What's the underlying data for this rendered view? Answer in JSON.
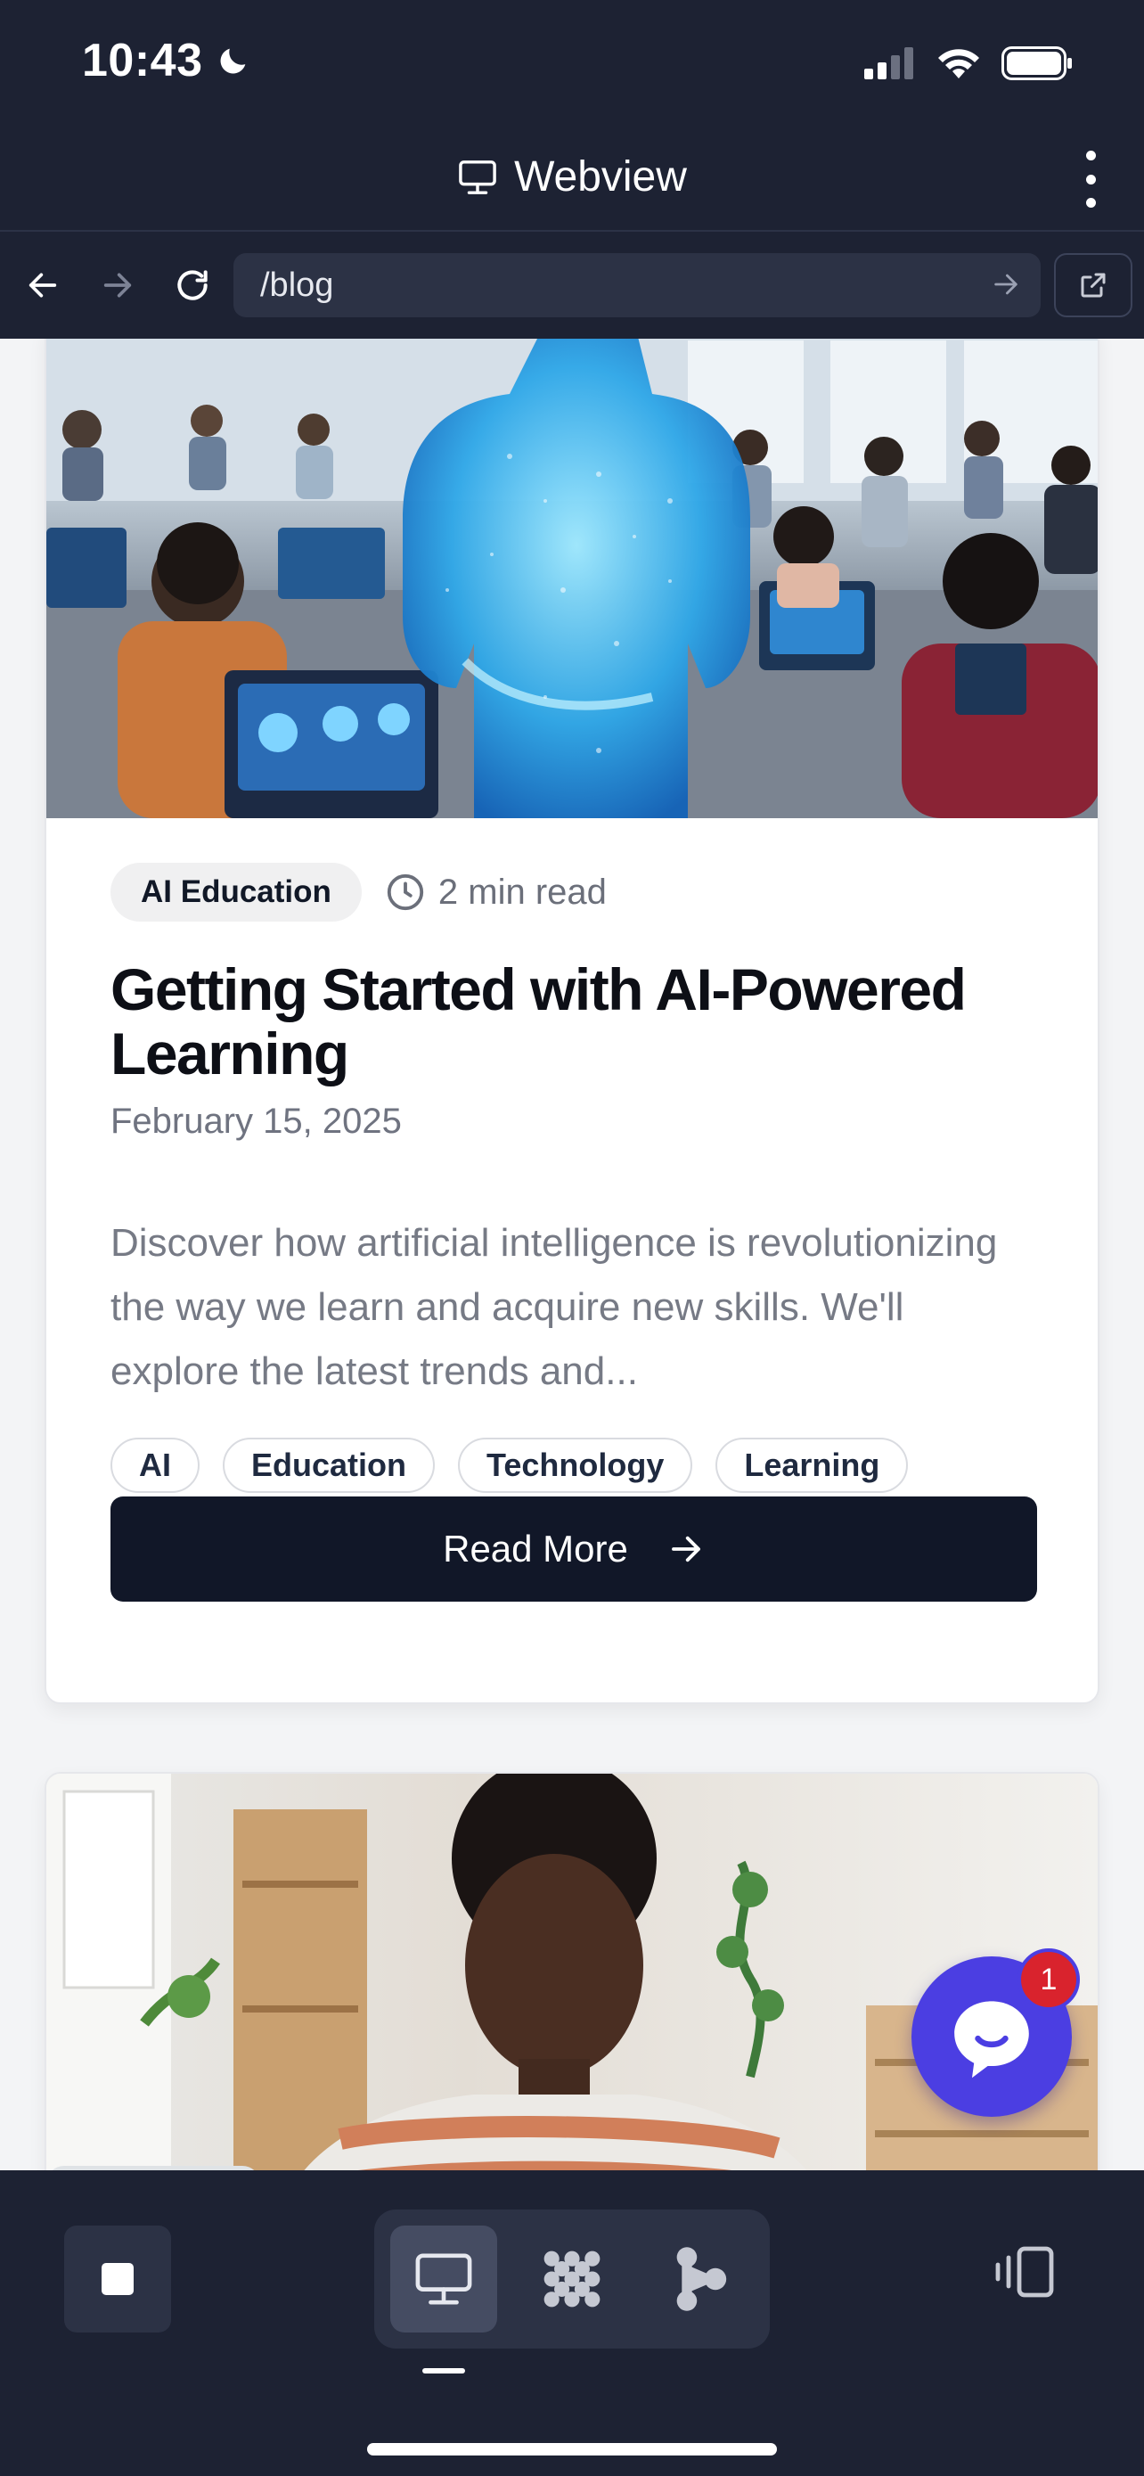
{
  "status_bar": {
    "time": "10:43",
    "icons": [
      "moon-icon",
      "signal-icon",
      "wifi-icon",
      "battery-icon"
    ]
  },
  "title_bar": {
    "icon": "monitor-icon",
    "title": "Webview",
    "menu_icon": "more-vertical-icon"
  },
  "address_bar": {
    "back_icon": "arrow-left-icon",
    "forward_icon": "arrow-right-icon",
    "reload_icon": "reload-icon",
    "url": "/blog",
    "go_icon": "arrow-right-icon",
    "external_icon": "external-link-icon"
  },
  "posts": [
    {
      "category": "AI Education",
      "read_time": "2 min read",
      "title": "Getting Started with AI-Powered Learning",
      "date": "February 15, 2025",
      "excerpt": "Discover how artificial intelligence is revolutionizing the way we learn and acquire new skills. We'll explore the latest trends and...",
      "tags": [
        "AI",
        "Education",
        "Technology",
        "Learning"
      ],
      "cta": "Read More"
    }
  ],
  "chat": {
    "badge_count": "1",
    "accent": "#4b3ee2",
    "badge_color": "#d9232d"
  },
  "bottom_bar": {
    "stop_icon": "stop-icon",
    "modes": [
      "monitor-icon",
      "grid-dots-icon",
      "branch-icon"
    ],
    "active_mode": "monitor-icon",
    "rotate_icon": "rotate-device-icon"
  },
  "colors": {
    "chrome": "#1d2233",
    "primary_button": "#111728",
    "page_background": "#f3f4f6"
  }
}
